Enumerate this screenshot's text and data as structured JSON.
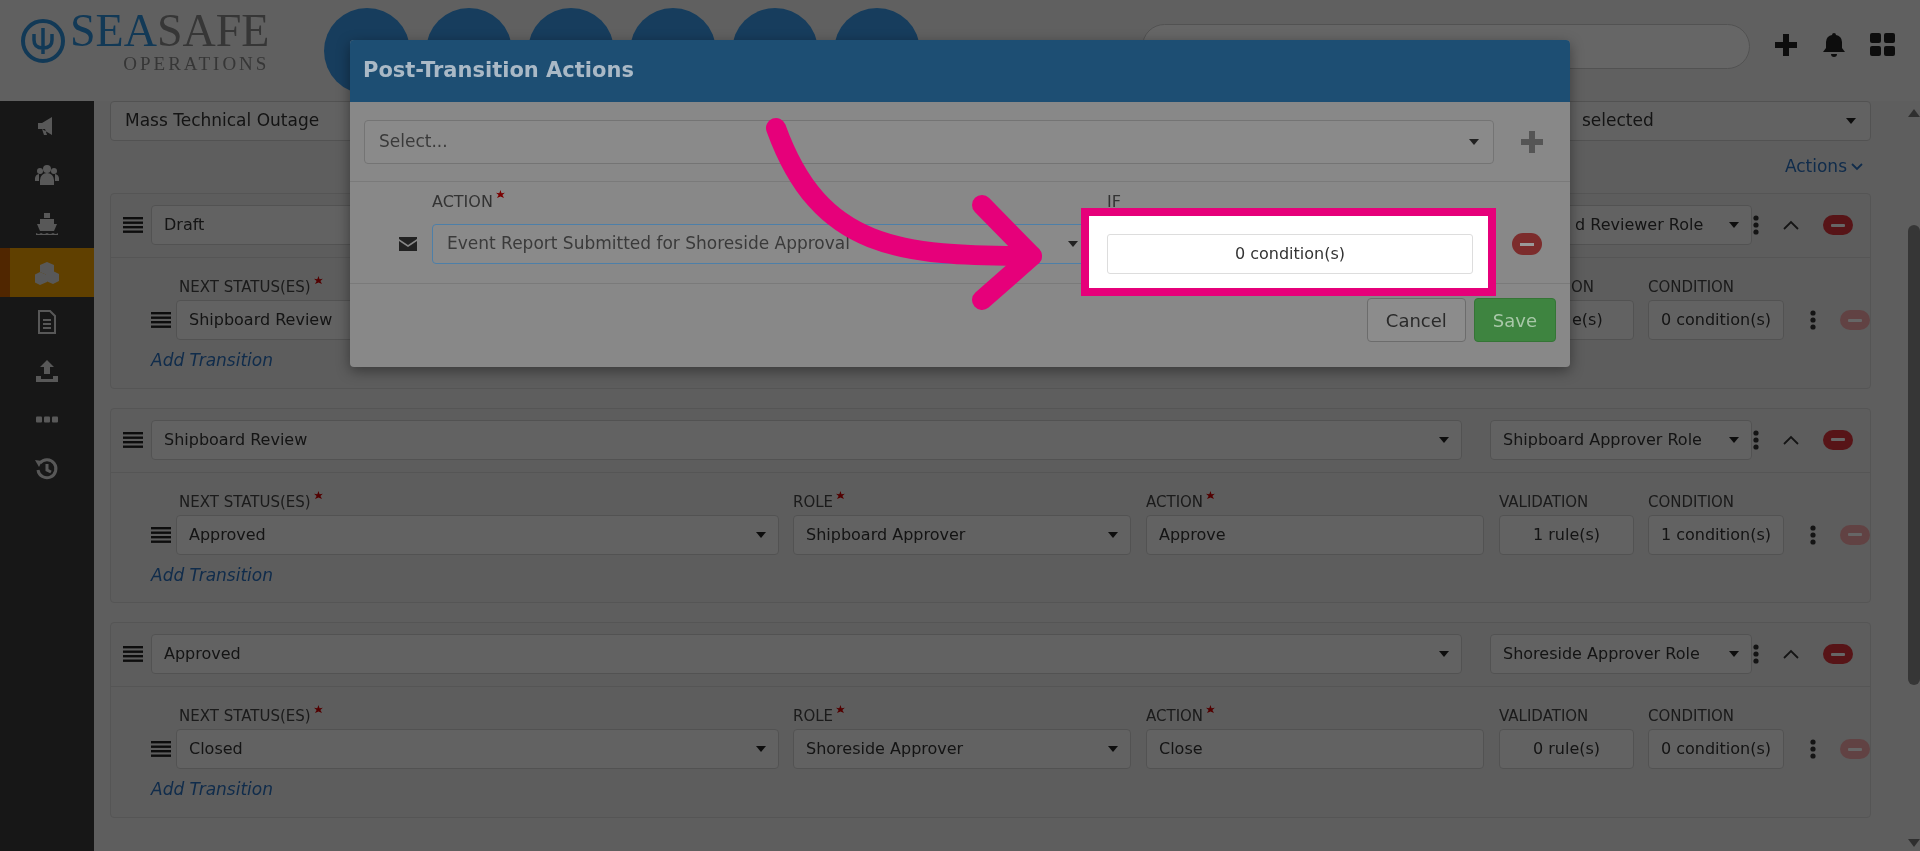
{
  "header": {
    "logo": {
      "brand_part_1": "SEA",
      "brand_part_2": "SAFE",
      "tagline": "OPERATIONS"
    }
  },
  "sidebar": {
    "items": [
      {
        "selected": false
      },
      {
        "selected": false
      },
      {
        "selected": false
      },
      {
        "selected": true
      },
      {
        "selected": false
      },
      {
        "selected": false
      },
      {
        "selected": false
      },
      {
        "selected": false
      }
    ]
  },
  "filters": {
    "event_type": "Mass Technical Outage",
    "roles": "selected"
  },
  "actions_menu": "Actions",
  "statuses": [
    {
      "status": "Draft",
      "role": "d Reviewer Role",
      "expanded": true,
      "labels": {
        "next_status": {
          "text": "NEXT STATUS(ES)",
          "required": true
        },
        "validation": {
          "text": "ON",
          "required": false
        },
        "condition": {
          "text": "CONDITION",
          "required": false
        }
      },
      "transitions": [
        {
          "next_status": "Shipboard Review",
          "validation": "e(s)",
          "condition": "0 condition(s)",
          "remove_disabled": true
        }
      ],
      "add_transition": "Add Transition"
    },
    {
      "status": "Shipboard Review",
      "role": "Shipboard Approver Role",
      "expanded": true,
      "labels": {
        "next_status": {
          "text": "NEXT STATUS(ES)",
          "required": true
        },
        "role": {
          "text": "ROLE",
          "required": true
        },
        "action": {
          "text": "ACTION",
          "required": true
        },
        "validation": {
          "text": "VALIDATION",
          "required": false
        },
        "condition": {
          "text": "CONDITION",
          "required": false
        }
      },
      "transitions": [
        {
          "next_status": "Approved",
          "role": "Shipboard Approver",
          "action": "Approve",
          "validation": "1 rule(s)",
          "condition": "1 condition(s)",
          "remove_disabled": true
        }
      ],
      "add_transition": "Add Transition"
    },
    {
      "status": "Approved",
      "role": "Shoreside Approver Role",
      "expanded": true,
      "labels": {
        "next_status": {
          "text": "NEXT STATUS(ES)",
          "required": true
        },
        "role": {
          "text": "ROLE",
          "required": true
        },
        "action": {
          "text": "ACTION",
          "required": true
        },
        "validation": {
          "text": "VALIDATION",
          "required": false
        },
        "condition": {
          "text": "CONDITION",
          "required": false
        }
      },
      "transitions": [
        {
          "next_status": "Closed",
          "role": "Shoreside Approver",
          "action": "Close",
          "validation": "0 rule(s)",
          "condition": "0 condition(s)",
          "remove_disabled": true
        }
      ],
      "add_transition": "Add Transition"
    }
  ],
  "modal": {
    "title": "Post-Transition Actions",
    "select_placeholder": "Select...",
    "columns": [
      {
        "text": "ACTION",
        "required": true
      },
      {
        "text": "IF",
        "required": false
      }
    ],
    "rows": [
      {
        "action": "Event Report Submitted for Shoreside Approval",
        "condition": "0 condition(s)"
      }
    ],
    "buttons": [
      {
        "label": "Cancel",
        "kind": "secondary"
      },
      {
        "label": "Save",
        "kind": "primary"
      }
    ]
  }
}
